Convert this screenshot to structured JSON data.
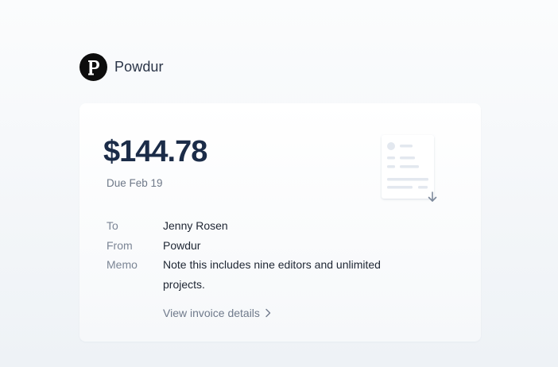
{
  "brand": {
    "logo_letter": "p",
    "name": "Powdur"
  },
  "invoice": {
    "amount": "$144.78",
    "due": "Due Feb 19",
    "to_label": "To",
    "to_value": "Jenny Rosen",
    "from_label": "From",
    "from_value": "Powdur",
    "memo_label": "Memo",
    "memo_value": "Note this includes nine editors and unlimited projects.",
    "view_link": "View invoice details"
  },
  "icons": {
    "brand_logo": "powdur-logo-icon",
    "document": "invoice-document-icon",
    "download": "download-arrow-icon",
    "chevron": "chevron-right-icon"
  },
  "colors": {
    "amount": "#1b2c48",
    "muted": "#7b8595",
    "logo_bg": "#0d0d0d"
  }
}
